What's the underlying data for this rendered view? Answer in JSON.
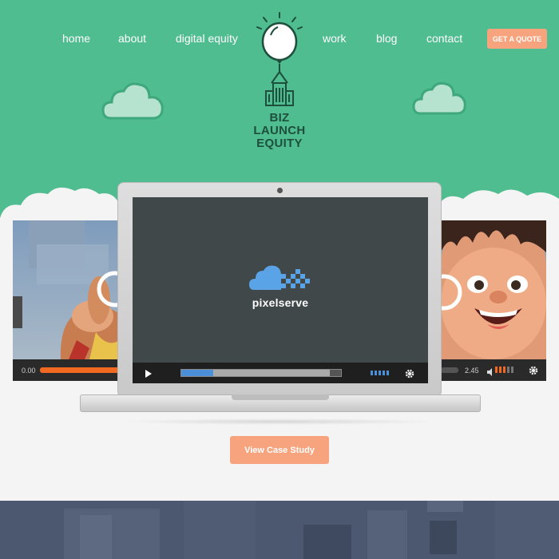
{
  "nav": {
    "left": [
      "home",
      "about",
      "digital equity"
    ],
    "right": [
      "work",
      "blog",
      "contact"
    ],
    "cta": "GET A QUOTE"
  },
  "logo": {
    "lines": [
      "BIZ",
      "LAUNCH",
      "EQUITY"
    ]
  },
  "showcase": {
    "brand": "pixelserve",
    "left_player_time": "0.00",
    "right_player_time": "2.45",
    "main_progress": 0.2,
    "main_buffered": 0.93
  },
  "case_study": {
    "button": "View Case Study"
  },
  "colors": {
    "hero": "#4fbd8f",
    "accent": "#f7a47e",
    "band": "#4c5870",
    "progress": "#4b8fd9",
    "left_scrub": "#f26a21"
  },
  "icons": [
    "balloon-icon",
    "building-icon",
    "cloud-icon",
    "play-icon",
    "gear-icon",
    "volume-icon"
  ]
}
